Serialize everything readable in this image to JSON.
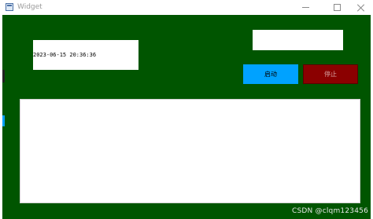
{
  "window": {
    "title": "Widget",
    "controls": {
      "minimize_icon": "minimize-icon",
      "maximize_icon": "maximize-icon",
      "close_icon": "close-icon"
    }
  },
  "colors": {
    "background": "#005500",
    "start_button": "#00a2ff",
    "stop_button": "#8b0000"
  },
  "time_display": {
    "value": "2023-06-15 20:36:36"
  },
  "top_input": {
    "value": ""
  },
  "buttons": {
    "start_label": "启动",
    "stop_label": "停止"
  },
  "text_area": {
    "value": ""
  },
  "watermark": {
    "text": "CSDN @clqm123456"
  }
}
